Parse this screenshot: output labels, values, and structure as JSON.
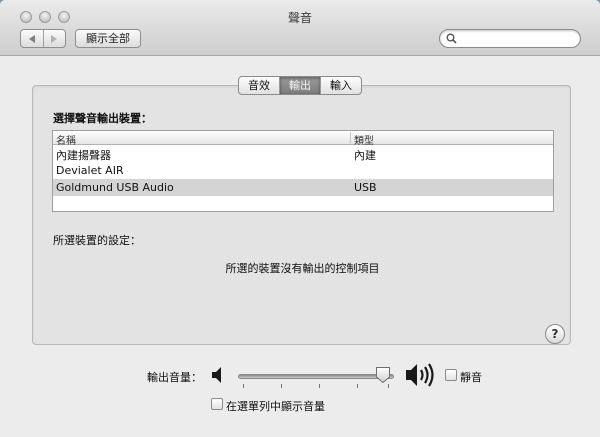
{
  "window": {
    "title": "聲音"
  },
  "toolbar": {
    "show_all_label": "顯示全部",
    "search_placeholder": ""
  },
  "tabs": [
    {
      "label": "音效",
      "active": false
    },
    {
      "label": "輸出",
      "active": true
    },
    {
      "label": "輸入",
      "active": false
    }
  ],
  "output": {
    "choose_label": "選擇聲音輸出裝置：",
    "columns": {
      "name": "名稱",
      "type": "類型"
    },
    "devices": [
      {
        "name": "內建揚聲器",
        "type": "內建",
        "selected": false
      },
      {
        "name": "Devialet AIR",
        "type": "",
        "selected": false
      },
      {
        "name": "Goldmund USB Audio",
        "type": "USB",
        "selected": true
      }
    ],
    "settings_label": "所選裝置的設定：",
    "no_controls_text": "所選的裝置沒有輸出的控制項目",
    "help_label": "?"
  },
  "volume": {
    "label": "輸出音量：",
    "level": 0.98,
    "mute_label": "靜音",
    "mute_checked": false,
    "show_in_menu_label": "在選單列中顯示音量",
    "show_in_menu_checked": false
  },
  "colors": {
    "selected_row": "#d4d4d4",
    "active_tab": "#8a8a8a",
    "window_bg": "#ececec"
  }
}
